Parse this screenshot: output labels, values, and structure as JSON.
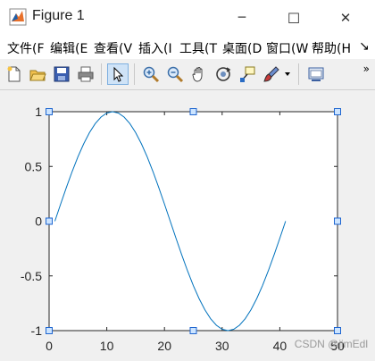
{
  "window": {
    "title": "Figure 1",
    "minimize_glyph": "─",
    "maximize_glyph": "☐",
    "close_glyph": "✕"
  },
  "menu": {
    "items": [
      {
        "label": "文件(F"
      },
      {
        "label": "编辑(E"
      },
      {
        "label": "查看(V"
      },
      {
        "label": "插入(I"
      },
      {
        "label": "工具(T"
      },
      {
        "label": "桌面(D"
      },
      {
        "label": "窗口(W"
      },
      {
        "label": "帮助(H"
      }
    ],
    "overflow_glyph": "↘"
  },
  "toolbar": {
    "buttons": [
      {
        "name": "new-figure-icon"
      },
      {
        "name": "open-file-icon"
      },
      {
        "name": "save-icon"
      },
      {
        "name": "print-icon"
      },
      {
        "name": "pointer-icon",
        "active": true
      },
      {
        "name": "zoom-in-icon"
      },
      {
        "name": "zoom-out-icon"
      },
      {
        "name": "pan-hand-icon"
      },
      {
        "name": "rotate-3d-icon"
      },
      {
        "name": "data-cursor-icon"
      },
      {
        "name": "brush-icon"
      },
      {
        "name": "plot-tools-icon"
      }
    ],
    "overflow_glyph": "»"
  },
  "colors": {
    "line": "#0072bd",
    "axes_bg": "#ffffff",
    "handle_fill": "#cce4ff",
    "handle_stroke": "#1f66d0"
  },
  "chart_data": {
    "type": "line",
    "function": "sin",
    "x_range": [
      1,
      41
    ],
    "series": [
      {
        "x": [
          1,
          2,
          3,
          4,
          5,
          6,
          7,
          8,
          9,
          10,
          11,
          12,
          13,
          14,
          15,
          16,
          17,
          18,
          19,
          20,
          21,
          22,
          23,
          24,
          25,
          26,
          27,
          28,
          29,
          30,
          31,
          32,
          33,
          34,
          35,
          36,
          37,
          38,
          39,
          40,
          41
        ],
        "values": [
          0,
          0.156,
          0.309,
          0.454,
          0.588,
          0.707,
          0.809,
          0.891,
          0.951,
          0.988,
          1,
          0.988,
          0.951,
          0.891,
          0.809,
          0.707,
          0.588,
          0.454,
          0.309,
          0.156,
          0,
          -0.156,
          -0.309,
          -0.454,
          -0.588,
          -0.707,
          -0.809,
          -0.891,
          -0.951,
          -0.988,
          -1,
          -0.988,
          -0.951,
          -0.891,
          -0.809,
          -0.707,
          -0.588,
          -0.454,
          -0.309,
          -0.156,
          0
        ]
      }
    ],
    "xlim": [
      0,
      50
    ],
    "ylim": [
      -1,
      1
    ],
    "xticks": [
      "0",
      "10",
      "20",
      "30",
      "40",
      "50"
    ],
    "yticks": [
      "1",
      "0.5",
      "0",
      "-0.5",
      "-1"
    ],
    "grid": false
  },
  "watermark": "CSDN @jimEdl"
}
